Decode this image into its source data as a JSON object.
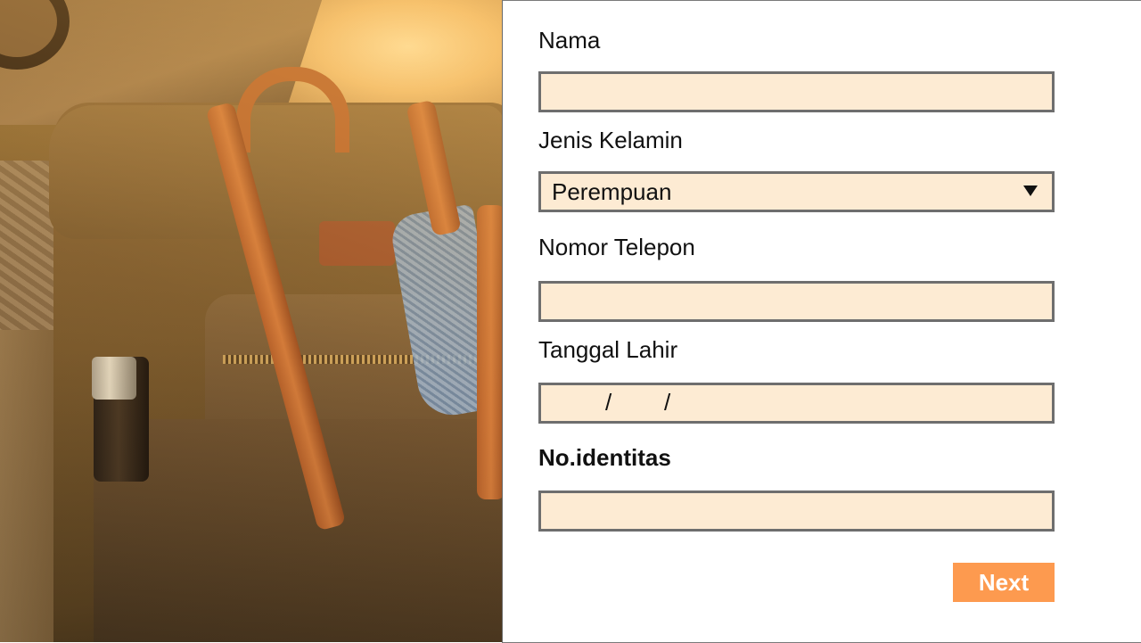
{
  "form": {
    "name_label": "Nama",
    "name_value": "",
    "gender_label": "Jenis Kelamin",
    "gender_selected": "Perempuan",
    "phone_label": "Nomor Telepon",
    "phone_value": "",
    "birthdate_label": "Tanggal Lahir",
    "birthdate_separator_1": "/",
    "birthdate_separator_2": "/",
    "id_label": "No.identitas",
    "id_value": "",
    "next_label": "Next"
  },
  "colors": {
    "field_bg": "#fdebd3",
    "field_border": "#6e6e6e",
    "button_bg": "#fd9a4f",
    "button_text": "#ffffff"
  },
  "icons": {
    "dropdown": "triangle-down-icon"
  }
}
